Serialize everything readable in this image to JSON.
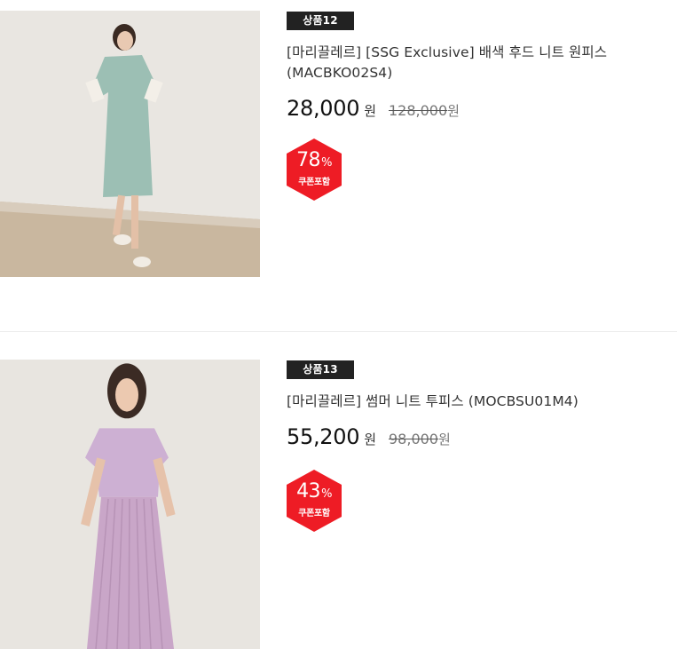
{
  "products": [
    {
      "badge": "상품12",
      "name": "[마리끌레르] [SSG Exclusive] 배색 후드 니트 원피스 (MACBKO02S4)",
      "price": "28,000",
      "currency": "원",
      "original_price": "128,000",
      "original_currency": "원",
      "discount_value": "78",
      "discount_unit": "%",
      "coupon_label": "쿠폰포함",
      "image_icon": "model-knit-dress-image"
    },
    {
      "badge": "상품13",
      "name": "[마리끌레르] 썸머 니트 투피스 (MOCBSU01M4)",
      "price": "55,200",
      "currency": "원",
      "original_price": "98,000",
      "original_currency": "원",
      "discount_value": "43",
      "discount_unit": "%",
      "coupon_label": "쿠폰포함",
      "image_icon": "model-knit-twopiece-image"
    }
  ],
  "colors": {
    "badge_bg": "#222222",
    "discount_red": "#ee1c25",
    "text": "#333333"
  }
}
